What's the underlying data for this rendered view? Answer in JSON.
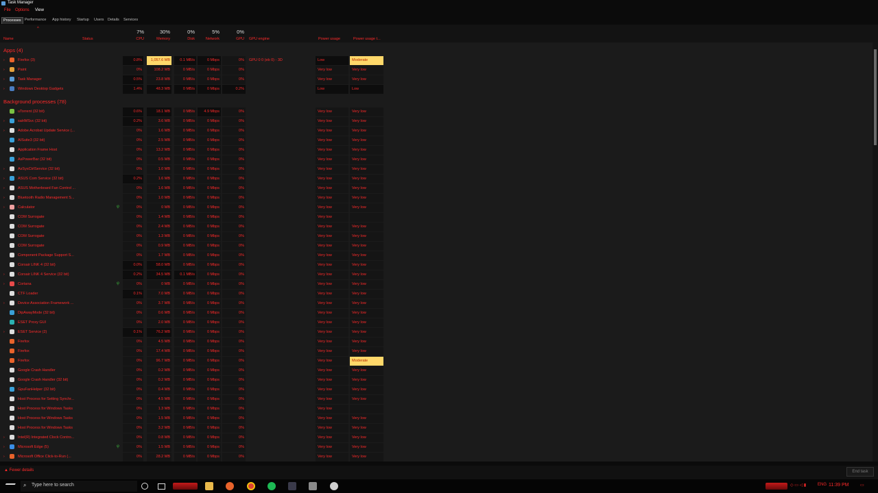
{
  "window": {
    "title": "Task Manager"
  },
  "menu": [
    "File",
    "Options",
    "View"
  ],
  "tabs": [
    "Processes",
    "Performance",
    "App history",
    "Startup",
    "Users",
    "Details",
    "Services"
  ],
  "columns": {
    "name": "Name",
    "status": "Status",
    "cpu": {
      "pct": "7%",
      "label": "CPU"
    },
    "memory": {
      "pct": "30%",
      "label": "Memory"
    },
    "disk": {
      "pct": "0%",
      "label": "Disk"
    },
    "network": {
      "pct": "5%",
      "label": "Network"
    },
    "gpu": {
      "pct": "0%",
      "label": "GPU"
    },
    "gpu_engine": "GPU engine",
    "power": "Power usage",
    "power_trend": "Power usage t..."
  },
  "groups": {
    "apps": "Apps (4)",
    "background": "Background processes (78)"
  },
  "apps": [
    {
      "name": "Firefox (3)",
      "exp": "›",
      "icon": "#e8632b",
      "cpu": "0.8%",
      "mem": "1,057.6 MB",
      "disk": "0.1 MB/s",
      "net": "0 Mbps",
      "gpu": "0%",
      "engine": "GPU 0 0 (eb 0) - 3D",
      "power": "Low",
      "trend": "Moderate",
      "hot": [
        "cpu",
        "disk",
        "net"
      ],
      "memY": true,
      "trendY": true,
      "plow": true
    },
    {
      "name": "Paint",
      "exp": "›",
      "icon": "#e6a23c",
      "cpu": "0%",
      "mem": "108.2 MB",
      "disk": "0 MB/s",
      "net": "0 Mbps",
      "gpu": "0%",
      "engine": "",
      "power": "Very low",
      "trend": "Very low"
    },
    {
      "name": "Task Manager",
      "exp": "›",
      "icon": "#5b9bd5",
      "cpu": "0.5%",
      "mem": "23.8 MB",
      "disk": "0 MB/s",
      "net": "0 Mbps",
      "gpu": "0%",
      "engine": "",
      "power": "Very low",
      "trend": "Very low",
      "hot": [
        "cpu"
      ]
    },
    {
      "name": "Windows Desktop Gadgets",
      "exp": "›",
      "icon": "#4a7cc0",
      "cpu": "1.4%",
      "mem": "48.3 MB",
      "disk": "0 MB/s",
      "net": "0 Mbps",
      "gpu": "0.2%",
      "engine": "",
      "power": "Low",
      "trend": "Low",
      "hot": [
        "cpu",
        "mem",
        "disk",
        "net",
        "gpu"
      ],
      "plow": true
    }
  ],
  "background": [
    {
      "name": "uTorrent (32 bit)",
      "exp": "",
      "icon": "#7ac143",
      "cpu": "0.6%",
      "mem": "18.1 MB",
      "disk": "0 MB/s",
      "net": "4.9 Mbps",
      "gpu": "0%",
      "power": "Very low",
      "trend": "Very low",
      "hot": [
        "cpu",
        "mem",
        "net"
      ]
    },
    {
      "name": "saHMSvc (32 bit)",
      "exp": "›",
      "icon": "#3aa0d8",
      "cpu": "0.2%",
      "mem": "3.6 MB",
      "disk": "0 MB/s",
      "net": "0 Mbps",
      "gpu": "0%",
      "power": "Very low",
      "trend": "Very low",
      "hot": [
        "cpu"
      ]
    },
    {
      "name": "Adobe Acrobat Update Service (...",
      "exp": "›",
      "icon": "#dddddd",
      "cpu": "0%",
      "mem": "1.6 MB",
      "disk": "0 MB/s",
      "net": "0 Mbps",
      "gpu": "0%",
      "power": "Very low",
      "trend": "Very low"
    },
    {
      "name": "AISuite3 (32 bit)",
      "exp": "",
      "icon": "#3aa0d8",
      "cpu": "0%",
      "mem": "2.5 MB",
      "disk": "0 MB/s",
      "net": "0 Mbps",
      "gpu": "0%",
      "power": "Very low",
      "trend": "Very low"
    },
    {
      "name": "Application Frame Host",
      "exp": "",
      "icon": "#dddddd",
      "cpu": "0%",
      "mem": "13.2 MB",
      "disk": "0 MB/s",
      "net": "0 Mbps",
      "gpu": "0%",
      "power": "Very low",
      "trend": "Very low"
    },
    {
      "name": "AsPowerBar (32 bit)",
      "exp": "",
      "icon": "#3aa0d8",
      "cpu": "0%",
      "mem": "0.5 MB",
      "disk": "0 MB/s",
      "net": "0 Mbps",
      "gpu": "0%",
      "power": "Very low",
      "trend": "Very low"
    },
    {
      "name": "AsSysCtrlService (32 bit)",
      "exp": "›",
      "icon": "#dddddd",
      "cpu": "0%",
      "mem": "1.0 MB",
      "disk": "0 MB/s",
      "net": "0 Mbps",
      "gpu": "0%",
      "power": "Very low",
      "trend": "Very low"
    },
    {
      "name": "ASUS Com Service (32 bit)",
      "exp": "›",
      "icon": "#3aa0d8",
      "cpu": "0.2%",
      "mem": "1.6 MB",
      "disk": "0 MB/s",
      "net": "0 Mbps",
      "gpu": "0%",
      "power": "Very low",
      "trend": "Very low",
      "hot": [
        "cpu"
      ]
    },
    {
      "name": "ASUS Motherboard Fan Control ...",
      "exp": "›",
      "icon": "#dddddd",
      "cpu": "0%",
      "mem": "1.6 MB",
      "disk": "0 MB/s",
      "net": "0 Mbps",
      "gpu": "0%",
      "power": "Very low",
      "trend": "Very low"
    },
    {
      "name": "Bluetooth Radio Management S...",
      "exp": "›",
      "icon": "#dddddd",
      "cpu": "0%",
      "mem": "1.0 MB",
      "disk": "0 MB/s",
      "net": "0 Mbps",
      "gpu": "0%",
      "power": "Very low",
      "trend": "Very low"
    },
    {
      "name": "Calculator",
      "exp": "›",
      "icon": "#f0a0a0",
      "cpu": "0%",
      "mem": "0 MB",
      "disk": "0 MB/s",
      "net": "0 Mbps",
      "gpu": "0%",
      "power": "Very low",
      "trend": "Very low",
      "leaf": true
    },
    {
      "name": "COM Surrogate",
      "exp": "",
      "icon": "#dddddd",
      "cpu": "0%",
      "mem": "1.4 MB",
      "disk": "0 MB/s",
      "net": "0 Mbps",
      "gpu": "0%",
      "power": "Very low",
      "trend": ""
    },
    {
      "name": "COM Surrogate",
      "exp": "",
      "icon": "#dddddd",
      "cpu": "0%",
      "mem": "2.4 MB",
      "disk": "0 MB/s",
      "net": "0 Mbps",
      "gpu": "0%",
      "power": "Very low",
      "trend": "Very low"
    },
    {
      "name": "COM Surrogate",
      "exp": "",
      "icon": "#dddddd",
      "cpu": "0%",
      "mem": "1.3 MB",
      "disk": "0 MB/s",
      "net": "0 Mbps",
      "gpu": "0%",
      "power": "Very low",
      "trend": "Very low"
    },
    {
      "name": "COM Surrogate",
      "exp": "",
      "icon": "#dddddd",
      "cpu": "0%",
      "mem": "0.9 MB",
      "disk": "0 MB/s",
      "net": "0 Mbps",
      "gpu": "0%",
      "power": "Very low",
      "trend": "Very low"
    },
    {
      "name": "Component Package Support S...",
      "exp": "",
      "icon": "#dddddd",
      "cpu": "0%",
      "mem": "1.7 MB",
      "disk": "0 MB/s",
      "net": "0 Mbps",
      "gpu": "0%",
      "power": "Very low",
      "trend": "Very low"
    },
    {
      "name": "Corsair LINK 4 (32 bit)",
      "exp": "",
      "icon": "#dddddd",
      "cpu": "0.0%",
      "mem": "58.0 MB",
      "disk": "0 MB/s",
      "net": "0 Mbps",
      "gpu": "0%",
      "power": "Very low",
      "trend": "Very low",
      "hot": [
        "cpu",
        "mem"
      ]
    },
    {
      "name": "Corsair LINK 4 Service (32 bit)",
      "exp": "›",
      "icon": "#dddddd",
      "cpu": "0.2%",
      "mem": "34.5 MB",
      "disk": "0.1 MB/s",
      "net": "0 Mbps",
      "gpu": "0%",
      "power": "Very low",
      "trend": "Very low",
      "hot": [
        "cpu",
        "mem",
        "disk"
      ]
    },
    {
      "name": "Cortana",
      "exp": "›",
      "icon": "#e84a4a",
      "cpu": "0%",
      "mem": "0 MB",
      "disk": "0 MB/s",
      "net": "0 Mbps",
      "gpu": "0%",
      "power": "Very low",
      "trend": "Very low",
      "leaf": true
    },
    {
      "name": "CTF Loader",
      "exp": "",
      "icon": "#dddddd",
      "cpu": "0.1%",
      "mem": "7.0 MB",
      "disk": "0 MB/s",
      "net": "0 Mbps",
      "gpu": "0%",
      "power": "Very low",
      "trend": "Very low",
      "hot": [
        "cpu"
      ]
    },
    {
      "name": "Device Association Framework ...",
      "exp": "›",
      "icon": "#dddddd",
      "cpu": "0%",
      "mem": "3.7 MB",
      "disk": "0 MB/s",
      "net": "0 Mbps",
      "gpu": "0%",
      "power": "Very low",
      "trend": "Very low"
    },
    {
      "name": "DipAwayMode (32 bit)",
      "exp": "",
      "icon": "#3aa0d8",
      "cpu": "0%",
      "mem": "0.6 MB",
      "disk": "0 MB/s",
      "net": "0 Mbps",
      "gpu": "0%",
      "power": "Very low",
      "trend": "Very low"
    },
    {
      "name": "ESET Proxy GUI",
      "exp": "",
      "icon": "#2bb3b3",
      "cpu": "0%",
      "mem": "2.0 MB",
      "disk": "0 MB/s",
      "net": "0 Mbps",
      "gpu": "0%",
      "power": "Very low",
      "trend": "Very low"
    },
    {
      "name": "ESET Service (2)",
      "exp": "›",
      "icon": "#dddddd",
      "cpu": "0.1%",
      "mem": "76.2 MB",
      "disk": "0 MB/s",
      "net": "0 Mbps",
      "gpu": "0%",
      "power": "Very low",
      "trend": "Very low",
      "hot": [
        "cpu",
        "mem"
      ]
    },
    {
      "name": "Firefox",
      "exp": "",
      "icon": "#e8632b",
      "cpu": "0%",
      "mem": "4.5 MB",
      "disk": "0 MB/s",
      "net": "0 Mbps",
      "gpu": "0%",
      "power": "Very low",
      "trend": "Very low"
    },
    {
      "name": "Firefox",
      "exp": "",
      "icon": "#e8632b",
      "cpu": "0%",
      "mem": "17.4 MB",
      "disk": "0 MB/s",
      "net": "0 Mbps",
      "gpu": "0%",
      "power": "Very low",
      "trend": "Very low"
    },
    {
      "name": "Firefox",
      "exp": "",
      "icon": "#e8632b",
      "cpu": "0%",
      "mem": "96.7 MB",
      "disk": "0 MB/s",
      "net": "0 Mbps",
      "gpu": "0%",
      "power": "Very low",
      "trend": "Moderate",
      "trendY": true
    },
    {
      "name": "Google Crash Handler",
      "exp": "",
      "icon": "#dddddd",
      "cpu": "0%",
      "mem": "0.2 MB",
      "disk": "0 MB/s",
      "net": "0 Mbps",
      "gpu": "0%",
      "power": "Very low",
      "trend": "Very low"
    },
    {
      "name": "Google Crash Handler (32 bit)",
      "exp": "",
      "icon": "#dddddd",
      "cpu": "0%",
      "mem": "0.2 MB",
      "disk": "0 MB/s",
      "net": "0 Mbps",
      "gpu": "0%",
      "power": "Very low",
      "trend": "Very low"
    },
    {
      "name": "GpuFanHelper (32 bit)",
      "exp": "",
      "icon": "#3aa0d8",
      "cpu": "0%",
      "mem": "0.4 MB",
      "disk": "0 MB/s",
      "net": "0 Mbps",
      "gpu": "0%",
      "power": "Very low",
      "trend": "Very low"
    },
    {
      "name": "Host Process for Setting Synchr...",
      "exp": "",
      "icon": "#dddddd",
      "cpu": "0%",
      "mem": "4.5 MB",
      "disk": "0 MB/s",
      "net": "0 Mbps",
      "gpu": "0%",
      "power": "Very low",
      "trend": "Very low"
    },
    {
      "name": "Host Process for Windows Tasks",
      "exp": "",
      "icon": "#dddddd",
      "cpu": "0%",
      "mem": "1.3 MB",
      "disk": "0 MB/s",
      "net": "0 Mbps",
      "gpu": "0%",
      "power": "Very low",
      "trend": ""
    },
    {
      "name": "Host Process for Windows Tasks",
      "exp": "",
      "icon": "#dddddd",
      "cpu": "0%",
      "mem": "1.5 MB",
      "disk": "0 MB/s",
      "net": "0 Mbps",
      "gpu": "0%",
      "power": "Very low",
      "trend": "Very low"
    },
    {
      "name": "Host Process for Windows Tasks",
      "exp": "",
      "icon": "#dddddd",
      "cpu": "0%",
      "mem": "3.2 MB",
      "disk": "0 MB/s",
      "net": "0 Mbps",
      "gpu": "0%",
      "power": "Very low",
      "trend": "Very low"
    },
    {
      "name": "Intel(R) Integrated Clock Contro...",
      "exp": "›",
      "icon": "#dddddd",
      "cpu": "0%",
      "mem": "0.8 MB",
      "disk": "0 MB/s",
      "net": "0 Mbps",
      "gpu": "0%",
      "power": "Very low",
      "trend": "Very low"
    },
    {
      "name": "Microsoft Edge (5)",
      "exp": "›",
      "icon": "#3a8ee6",
      "cpu": "0%",
      "mem": "1.5 MB",
      "disk": "0 MB/s",
      "net": "0 Mbps",
      "gpu": "0%",
      "power": "Very low",
      "trend": "Very low",
      "leaf": true
    },
    {
      "name": "Microsoft Office Click-to-Run (...",
      "exp": "›",
      "icon": "#e8632b",
      "cpu": "0%",
      "mem": "28.2 MB",
      "disk": "0 MB/s",
      "net": "0 Mbps",
      "gpu": "0%",
      "power": "Very low",
      "trend": "Very low"
    }
  ],
  "footer": {
    "fewer": "Fewer details",
    "end_task": "End task"
  },
  "taskbar": {
    "search_placeholder": "Type here to search",
    "lang": "ENG",
    "time": "11:39 PM"
  }
}
